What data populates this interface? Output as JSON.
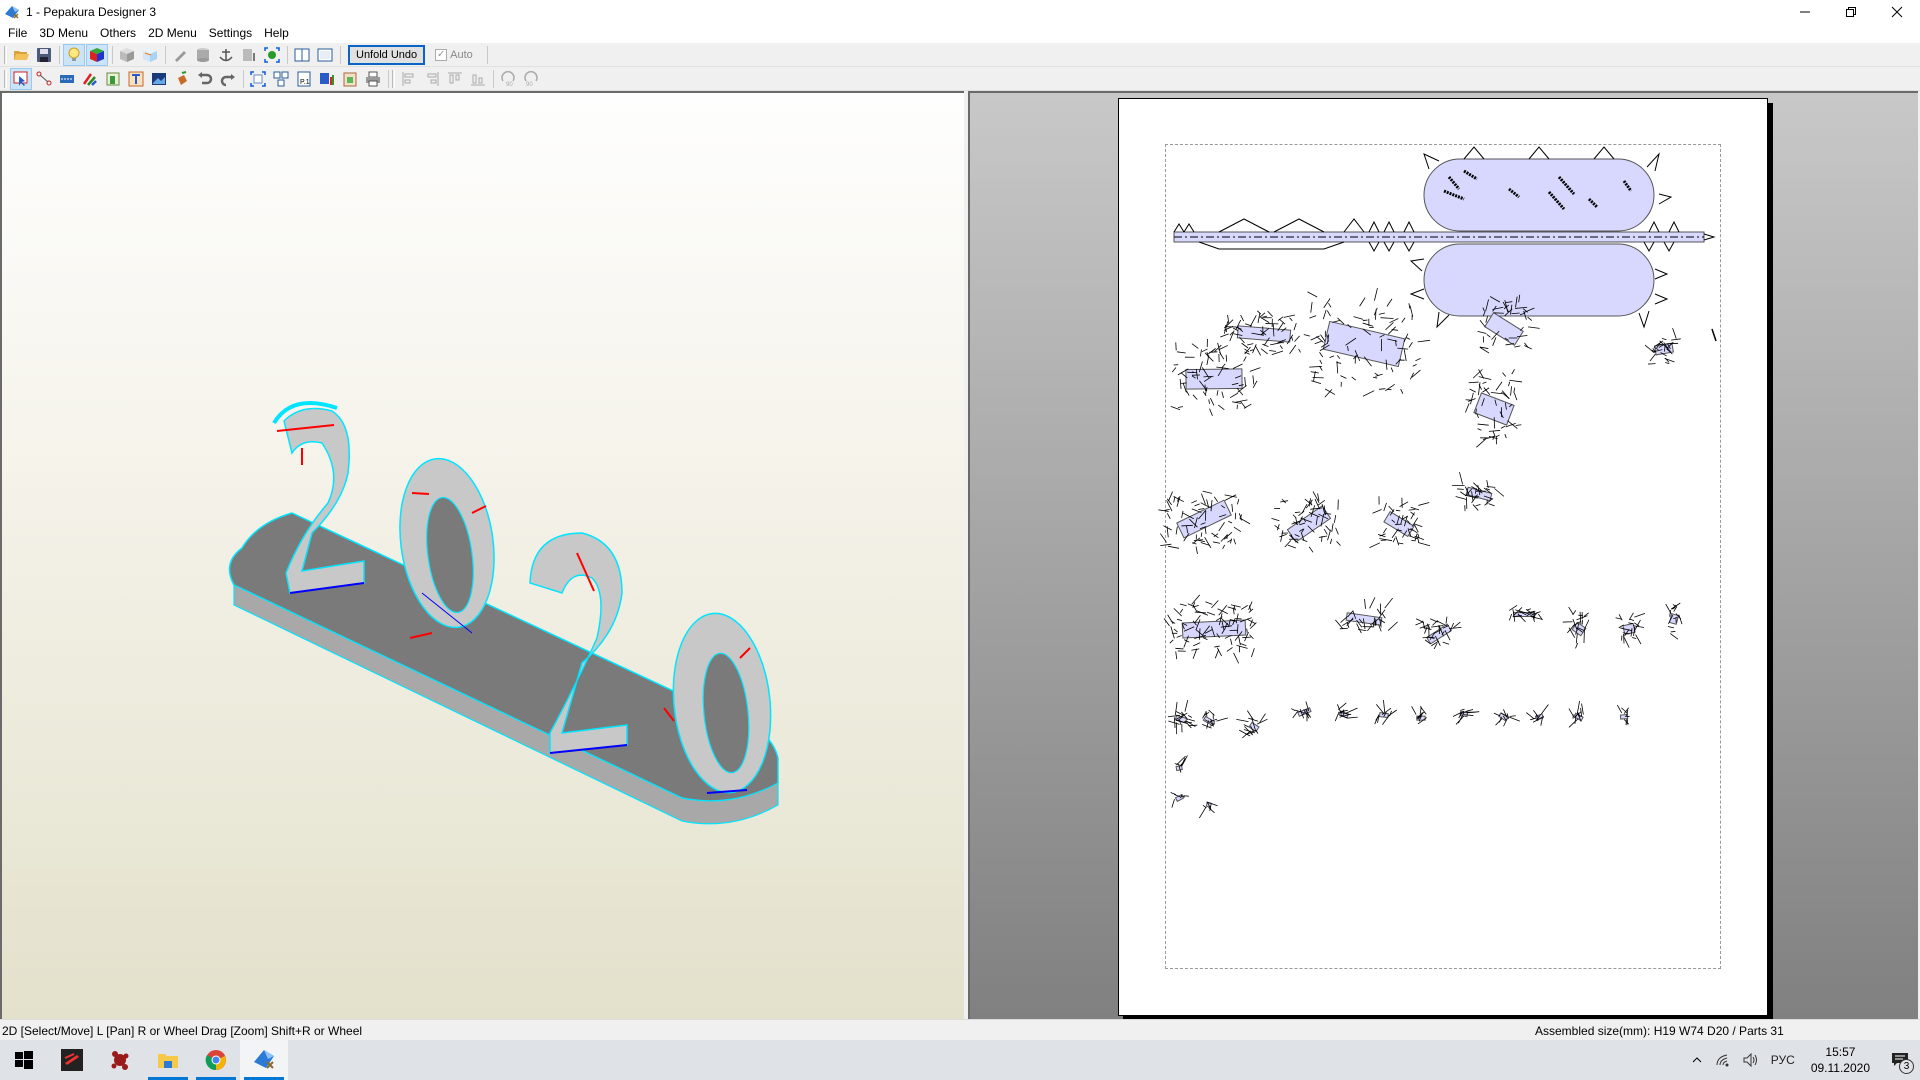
{
  "window": {
    "title": "1 - Pepakura Designer 3",
    "controls": [
      "minimize",
      "restore",
      "close"
    ]
  },
  "menu": {
    "items": [
      "File",
      "3D Menu",
      "Others",
      "2D Menu",
      "Settings",
      "Help"
    ]
  },
  "toolbar1": {
    "buttons": [
      {
        "icon": "open-folder-icon"
      },
      {
        "icon": "save-disk-icon"
      },
      {
        "icon": "light-bulb-icon",
        "pressed": true
      },
      {
        "icon": "colored-cube-icon",
        "pressed": true
      },
      {
        "icon": "gray-cube-icon"
      },
      {
        "icon": "edge-cube-icon"
      },
      {
        "icon": "pencil-icon"
      },
      {
        "icon": "cylinder-icon"
      },
      {
        "icon": "anchor-icon"
      },
      {
        "icon": "flap-icon"
      },
      {
        "icon": "fit-3d-icon"
      },
      {
        "icon": "split-view-icon"
      },
      {
        "icon": "single-view-icon"
      }
    ],
    "unfold_undo_label": "Unfold Undo",
    "auto_label": "Auto",
    "auto_checked": true
  },
  "toolbar2": {
    "buttons": [
      {
        "icon": "select-arrow-icon",
        "pressed": true
      },
      {
        "icon": "edge-nodes-icon"
      },
      {
        "icon": "flap-edit-icon"
      },
      {
        "icon": "color-pencils-icon"
      },
      {
        "icon": "texture-icon"
      },
      {
        "icon": "text-icon"
      },
      {
        "icon": "image-icon"
      },
      {
        "icon": "paint-bucket-icon"
      },
      {
        "icon": "undo-icon"
      },
      {
        "icon": "redo-icon"
      },
      {
        "icon": "fit-2d-icon"
      },
      {
        "icon": "arrange-icon"
      },
      {
        "icon": "page-number-icon"
      },
      {
        "icon": "save-layout-icon"
      },
      {
        "icon": "clipboard-icon"
      },
      {
        "icon": "print-icon"
      },
      {
        "icon": "align-left-icon"
      },
      {
        "icon": "align-right-icon"
      },
      {
        "icon": "align-top-icon"
      },
      {
        "icon": "align-bottom-icon"
      },
      {
        "icon": "rotate-ccw-90-icon"
      },
      {
        "icon": "rotate-cw-90-icon"
      }
    ]
  },
  "view3d": {
    "model_text": "2020",
    "edge_color": "#00e5ff",
    "face_color": "#c8c8c8",
    "base_color": "#7a7a7a",
    "cut_line_color": "#ff0000",
    "fold_line_color": "#0000ff"
  },
  "view2d": {
    "part_fill": "#d8d8ff",
    "page_count": 1
  },
  "status": {
    "hint": "2D [Select/Move] L [Pan] R or Wheel Drag [Zoom] Shift+R or Wheel",
    "assembled_size": "Assembled size(mm): H19 W74 D20 / Parts 31"
  },
  "taskbar": {
    "apps": [
      {
        "name": "start"
      },
      {
        "name": "forza"
      },
      {
        "name": "red-app"
      },
      {
        "name": "file-explorer",
        "running": true
      },
      {
        "name": "chrome",
        "running": true
      },
      {
        "name": "pepakura",
        "running": true,
        "active": true
      }
    ],
    "tray": {
      "language": "РУС",
      "time": "15:57",
      "date": "09.11.2020",
      "notifications": "3"
    }
  }
}
